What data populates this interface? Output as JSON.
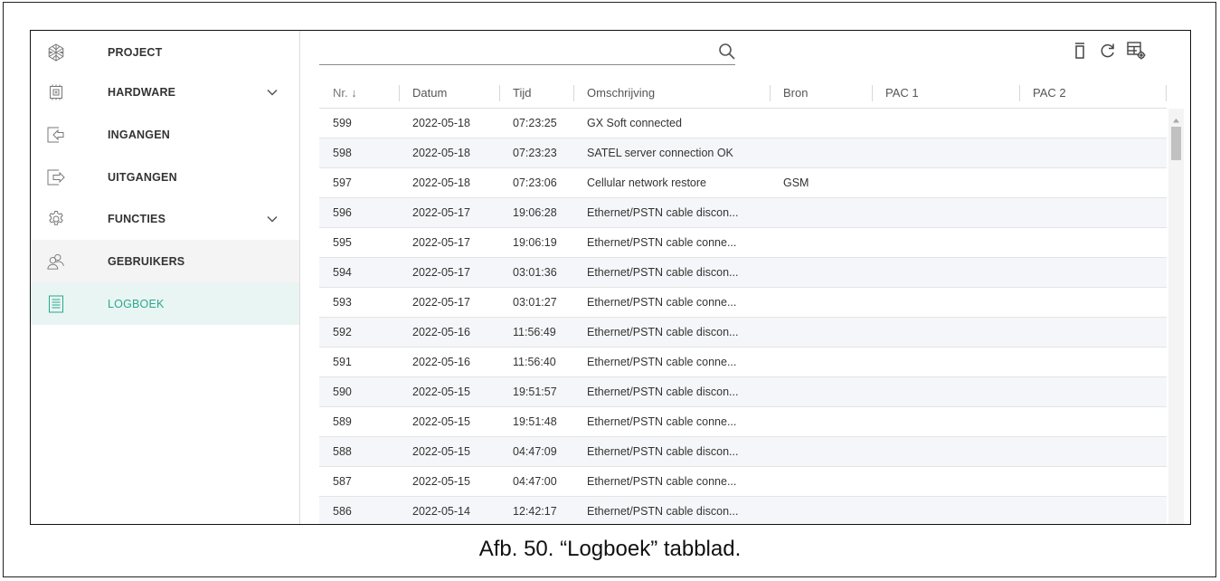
{
  "sidebar": {
    "items": [
      {
        "label": "PROJECT",
        "icon": "project-icon"
      },
      {
        "label": "HARDWARE",
        "icon": "hardware-chip-icon",
        "expandable": true
      },
      {
        "label": "INGANGEN",
        "icon": "input-arrow-icon"
      },
      {
        "label": "UITGANGEN",
        "icon": "output-arrow-icon"
      },
      {
        "label": "FUNCTIES",
        "icon": "gear-icon",
        "expandable": true
      },
      {
        "label": "GEBRUIKERS",
        "icon": "users-icon"
      },
      {
        "label": "LOGBOEK",
        "icon": "logbook-icon",
        "active": true
      }
    ]
  },
  "search": {
    "placeholder": "",
    "value": ""
  },
  "toolbar": [
    "delete-icon",
    "refresh-icon",
    "column-settings-icon"
  ],
  "table": {
    "columns": [
      {
        "label": "Nr. ↓"
      },
      {
        "label": "Datum"
      },
      {
        "label": "Tijd"
      },
      {
        "label": "Omschrijving"
      },
      {
        "label": "Bron"
      },
      {
        "label": "PAC 1"
      },
      {
        "label": "PAC 2"
      }
    ],
    "rows": [
      {
        "nr": "599",
        "datum": "2022-05-18",
        "tijd": "07:23:25",
        "omschrijving": "GX Soft connected",
        "bron": "",
        "pac1": "",
        "pac2": ""
      },
      {
        "nr": "598",
        "datum": "2022-05-18",
        "tijd": "07:23:23",
        "omschrijving": "SATEL server connection OK",
        "bron": "",
        "pac1": "",
        "pac2": ""
      },
      {
        "nr": "597",
        "datum": "2022-05-18",
        "tijd": "07:23:06",
        "omschrijving": "Cellular network restore",
        "bron": "GSM",
        "pac1": "",
        "pac2": ""
      },
      {
        "nr": "596",
        "datum": "2022-05-17",
        "tijd": "19:06:28",
        "omschrijving": "Ethernet/PSTN cable discon...",
        "bron": "",
        "pac1": "",
        "pac2": ""
      },
      {
        "nr": "595",
        "datum": "2022-05-17",
        "tijd": "19:06:19",
        "omschrijving": "Ethernet/PSTN cable conne...",
        "bron": "",
        "pac1": "",
        "pac2": ""
      },
      {
        "nr": "594",
        "datum": "2022-05-17",
        "tijd": "03:01:36",
        "omschrijving": "Ethernet/PSTN cable discon...",
        "bron": "",
        "pac1": "",
        "pac2": ""
      },
      {
        "nr": "593",
        "datum": "2022-05-17",
        "tijd": "03:01:27",
        "omschrijving": "Ethernet/PSTN cable conne...",
        "bron": "",
        "pac1": "",
        "pac2": ""
      },
      {
        "nr": "592",
        "datum": "2022-05-16",
        "tijd": "11:56:49",
        "omschrijving": "Ethernet/PSTN cable discon...",
        "bron": "",
        "pac1": "",
        "pac2": ""
      },
      {
        "nr": "591",
        "datum": "2022-05-16",
        "tijd": "11:56:40",
        "omschrijving": "Ethernet/PSTN cable conne...",
        "bron": "",
        "pac1": "",
        "pac2": ""
      },
      {
        "nr": "590",
        "datum": "2022-05-15",
        "tijd": "19:51:57",
        "omschrijving": "Ethernet/PSTN cable discon...",
        "bron": "",
        "pac1": "",
        "pac2": ""
      },
      {
        "nr": "589",
        "datum": "2022-05-15",
        "tijd": "19:51:48",
        "omschrijving": "Ethernet/PSTN cable conne...",
        "bron": "",
        "pac1": "",
        "pac2": ""
      },
      {
        "nr": "588",
        "datum": "2022-05-15",
        "tijd": "04:47:09",
        "omschrijving": "Ethernet/PSTN cable discon...",
        "bron": "",
        "pac1": "",
        "pac2": ""
      },
      {
        "nr": "587",
        "datum": "2022-05-15",
        "tijd": "04:47:00",
        "omschrijving": "Ethernet/PSTN cable conne...",
        "bron": "",
        "pac1": "",
        "pac2": ""
      },
      {
        "nr": "586",
        "datum": "2022-05-14",
        "tijd": "12:42:17",
        "omschrijving": "Ethernet/PSTN cable discon...",
        "bron": "",
        "pac1": "",
        "pac2": ""
      }
    ]
  },
  "colors": {
    "accent": "#2aa88e",
    "active_bg": "#e9f5f3",
    "row_alt": "#f5f6f9"
  },
  "caption": "Afb. 50. “Logboek” tabblad."
}
